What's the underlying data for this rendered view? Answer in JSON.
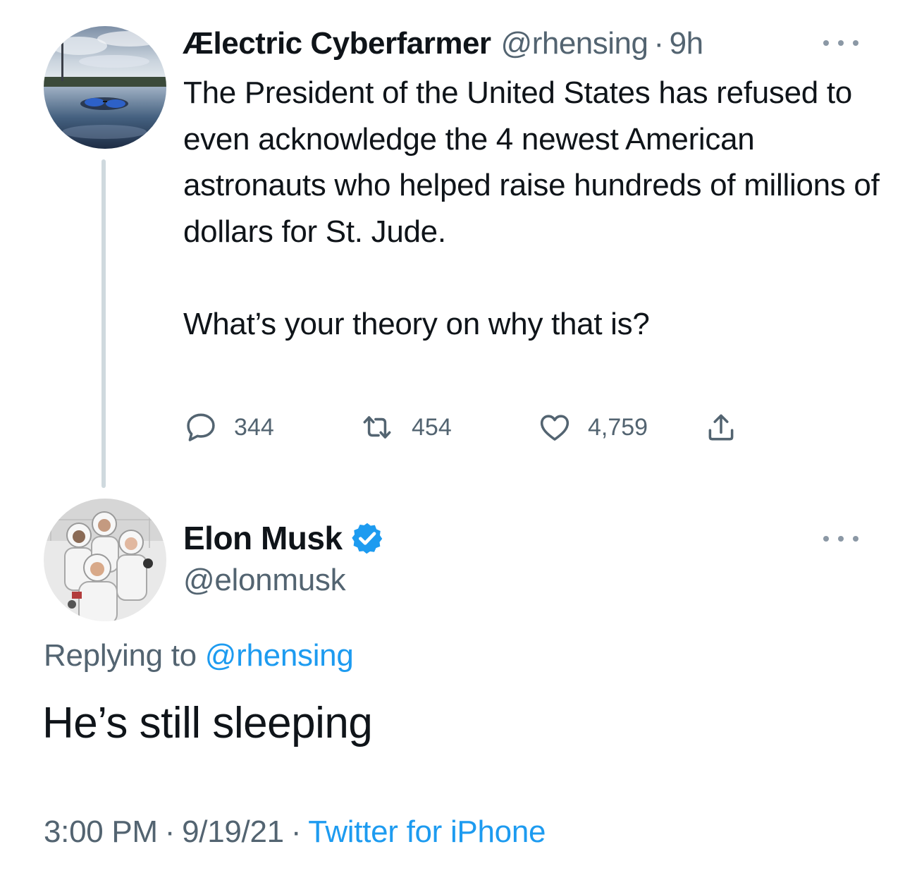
{
  "colors": {
    "text_primary": "#0f1419",
    "text_secondary": "#536471",
    "link": "#1d9bf0",
    "thread_line": "#cfd9de",
    "verified_badge": "#1d9bf0"
  },
  "parent_tweet": {
    "display_name": "Ælectric Cyberfarmer",
    "handle": "@rhensing",
    "separator": "·",
    "time_ago": "9h",
    "avatar_icon": "avatar-landscape-photo",
    "more_icon": "more-dots-icon",
    "text_paragraph_1": "The President of the United States has refused to even acknowledge the 4 newest American astronauts who helped raise hundreds of millions of dollars for St. Jude.",
    "text_paragraph_2": "What’s your theory on why that is?",
    "actions": {
      "reply": {
        "icon": "reply-bubble-icon",
        "count": "344"
      },
      "retweet": {
        "icon": "retweet-icon",
        "count": "454"
      },
      "like": {
        "icon": "heart-icon",
        "count": "4,759"
      },
      "share": {
        "icon": "share-upload-icon"
      }
    }
  },
  "reply_tweet": {
    "display_name": "Elon Musk",
    "handle": "@elonmusk",
    "verified_icon": "verified-badge-icon",
    "avatar_icon": "avatar-astronauts-photo",
    "more_icon": "more-dots-icon",
    "replying_prefix": "Replying to",
    "replying_to": "@rhensing",
    "text": "He’s still sleeping",
    "time": "3:00 PM",
    "date": "9/19/21",
    "separator": "·",
    "source": "Twitter for iPhone"
  }
}
